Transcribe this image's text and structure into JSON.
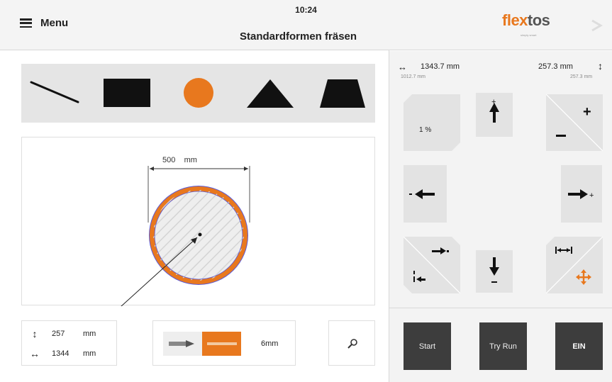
{
  "header": {
    "menu_label": "Menu",
    "time": "10:24",
    "title": "Standardformen fräsen",
    "logo_part1": "flex",
    "logo_part2": "tos",
    "logo_tagline": "simply smart"
  },
  "shapes": {
    "items": [
      "line",
      "rectangle",
      "circle",
      "triangle",
      "trapezoid"
    ],
    "selected": "circle",
    "accent_color": "#e8781e"
  },
  "canvas": {
    "dimension_value": "500",
    "dimension_unit": "mm",
    "shape": "circle",
    "outline_color": "#e8781e",
    "inner_outline_color": "#5a5ad8"
  },
  "position": {
    "vertical_value": "257",
    "vertical_unit": "mm",
    "horizontal_value": "1344",
    "horizontal_unit": "mm"
  },
  "tool": {
    "size": "6mm"
  },
  "coords": {
    "x_main": "1343.7  mm",
    "x_sub": "1012.7  mm",
    "y_main": "257.3  mm",
    "y_sub": "257.3   mm"
  },
  "jog": {
    "speed_label": "1  %",
    "up_label": "+",
    "up_sub": "-",
    "left_label": "-",
    "right_label": "+",
    "down_label": "-",
    "plus_label": "+",
    "minus_label": "–"
  },
  "actions": {
    "start": "Start",
    "try_run": "Try Run",
    "ein": "EIN"
  }
}
